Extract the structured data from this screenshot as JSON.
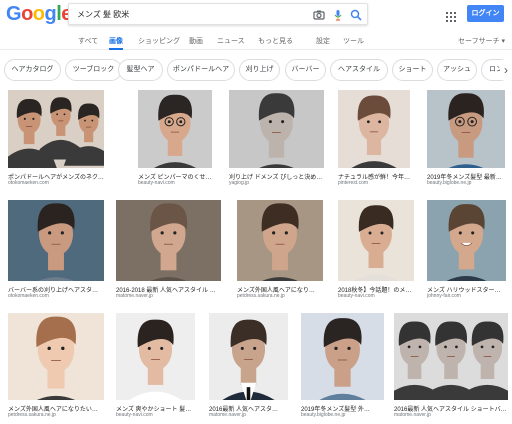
{
  "header": {
    "logo_letters": [
      "G",
      "o",
      "o",
      "g",
      "l",
      "e"
    ],
    "logo_colors": [
      "#4285f4",
      "#ea4335",
      "#fbbc05",
      "#4285f4",
      "#34a853",
      "#ea4335"
    ],
    "search_query": "メンズ 髪 欧米",
    "login_label": "ログイン"
  },
  "tabs": {
    "all": "すべて",
    "images": "画像",
    "shopping": "ショッピング",
    "videos": "動画",
    "news": "ニュース",
    "more": "もっと見る",
    "settings": "設定",
    "tools": "ツール",
    "safesearch": "セーフサーチ ▾"
  },
  "chips": [
    "ヘアカタログ",
    "ツーブロック",
    "髪型ヘア",
    "ポンパドールヘア",
    "刈り上げ",
    "バーバー",
    "ヘアスタイル",
    "ショート",
    "アッシュ",
    "ロン"
  ],
  "results": [
    {
      "caption": "ポンパドールヘアがメンズのネクストブ…",
      "source": "otokomaeken.com"
    },
    {
      "caption": "メンズ ピンパーマのくせ…",
      "source": "beauty-navi.com"
    },
    {
      "caption": "刈り上げ ドメンズ ぴしっと決める！…",
      "source": "yagiog.jp"
    },
    {
      "caption": "ナチュラル感が鮮！今年…",
      "source": "pinterest.com"
    },
    {
      "caption": "2019年冬メンズ髪型 最新…",
      "source": "beauty.biglobe.ne.jp"
    },
    {
      "caption": "バーバー系の刈り上げヘアスタ…",
      "source": "otokomaeken.com"
    },
    {
      "caption": "2016-2018 最新 人気ヘアスタイル メ…",
      "source": "matome.naver.jp"
    },
    {
      "caption": "メンズ外国人風ヘアになり…",
      "source": "petdress.sakura.ne.jp"
    },
    {
      "caption": "2018秋冬】今話題！のメン…",
      "source": "beauty-navi.com"
    },
    {
      "caption": "メンズ ハリウッドスター…",
      "source": "johnny-fair.com"
    },
    {
      "caption": "メンズ外国人風ヘアになりたい…",
      "source": "petdress.sakura.ne.jp"
    },
    {
      "caption": "メンズ 爽やかショート 髪…",
      "source": "beauty-navi.com"
    },
    {
      "caption": "2016最新 人気ヘアスタ…",
      "source": "matome.naver.jp"
    },
    {
      "caption": "2019年冬メンズ髪型 外…",
      "source": "beauty.biglobe.ne.jp"
    },
    {
      "caption": "2016最新 人気ヘアスタイル ショートバ…",
      "source": "matome.naver.jp"
    }
  ]
}
